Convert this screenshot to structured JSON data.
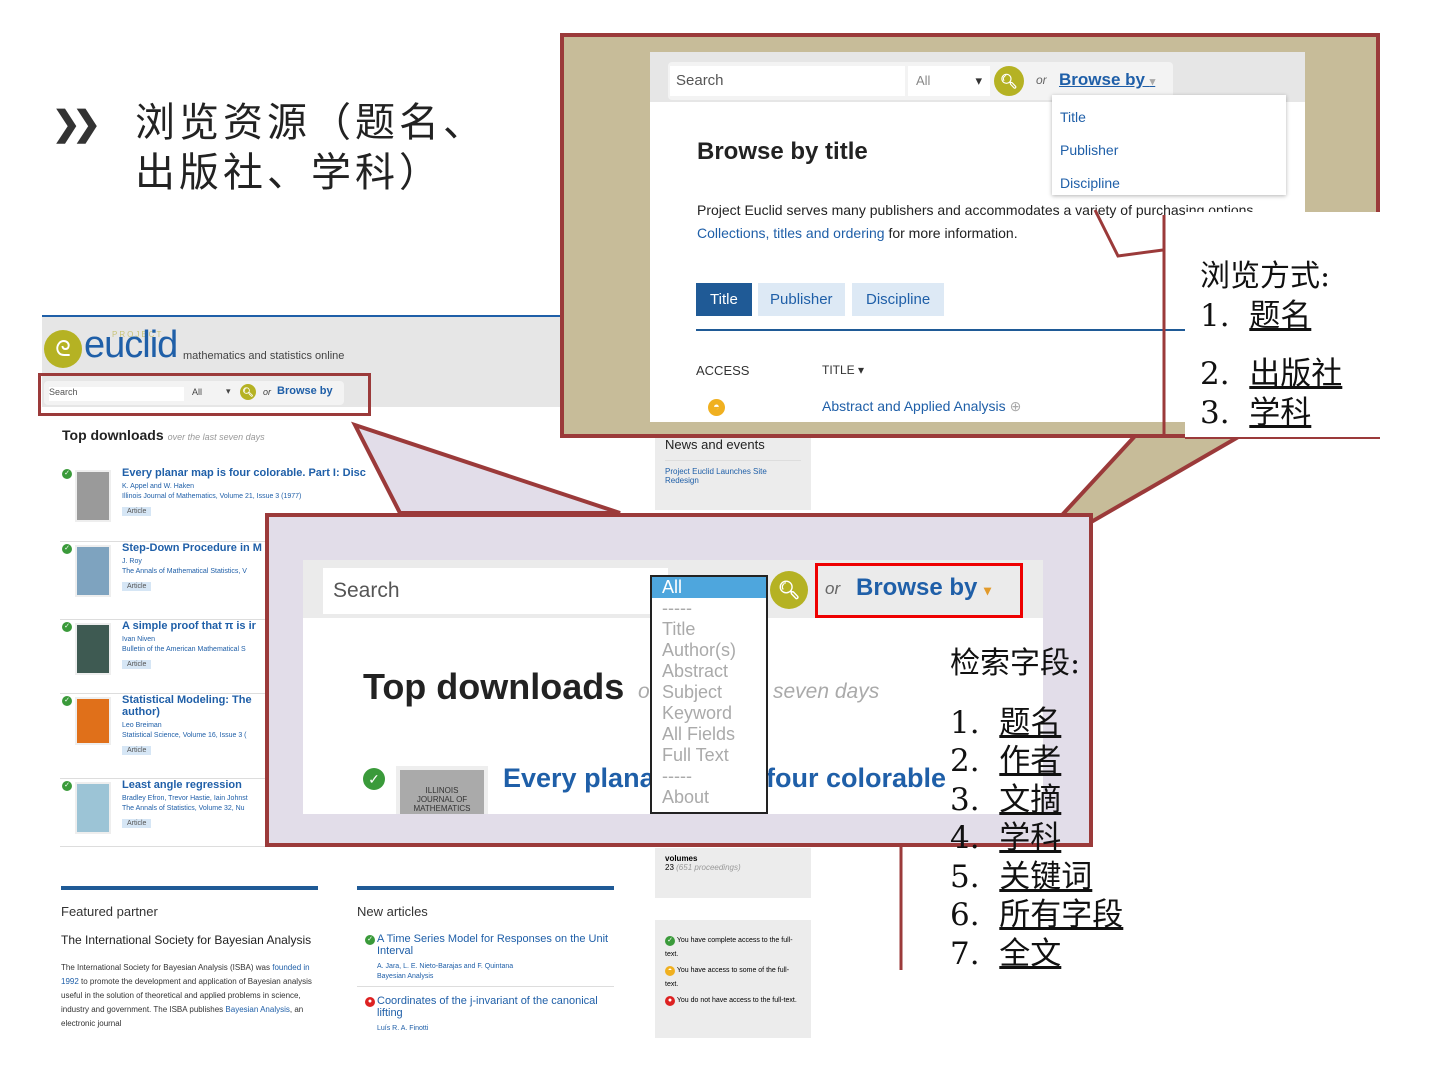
{
  "slide": {
    "title_line1": "浏览资源（题名、",
    "title_line2": "出版社、学科）",
    "bullet_icon": "double-chevron-icon"
  },
  "euclid": {
    "logo_project": "PROJECT",
    "logo": "euclid",
    "tagline": "mathematics and statistics online",
    "search_placeholder": "Search",
    "field_select": "All",
    "or": "or",
    "browse_by": "Browse by",
    "top_downloads": "Top downloads",
    "top_downloads_sub": "over the last seven days",
    "items": [
      {
        "title": "Every planar map is four colorable. Part I: Disc",
        "authors": "K. Appel and W. Haken",
        "source": "Illinois Journal of Mathematics, Volume 21, Issue 3 (1977)",
        "type": "Article"
      },
      {
        "title": "Step-Down Procedure in M",
        "authors": "J. Roy",
        "source": "The Annals of Mathematical Statistics, V",
        "type": "Article"
      },
      {
        "title": "A simple proof that π is ir",
        "authors": "Ivan Niven",
        "source": "Bulletin of the American Mathematical S",
        "type": "Article"
      },
      {
        "title": "Statistical Modeling: The",
        "title2": "author)",
        "authors": "Leo Breiman",
        "source": "Statistical Science, Volume 16, Issue 3 (",
        "type": "Article"
      },
      {
        "title": "Least angle regression",
        "authors": "Bradley Efron, Trevor Hastie, Iain Johnst",
        "source": "The Annals of Statistics, Volume 32, Nu",
        "type": "Article"
      }
    ],
    "news_title": "News and events",
    "news_item": "Project Euclid Launches Site Redesign",
    "volumes_label": "volumes",
    "volumes_value": "23",
    "volumes_sub": "(651 proceedings)",
    "featured_partner": "Featured partner",
    "partner_name": "The International Society for Bayesian Analysis",
    "partner_text_1": "The International Society for Bayesian Analysis (ISBA) was",
    "partner_link_1": "founded in 1992",
    "partner_text_2": "to promote the development and application of Bayesian analysis useful in the solution of theoretical and applied problems in science, industry and government. The ISBA publishes",
    "partner_link_2": "Bayesian Analysis",
    "partner_text_3": ", an electronic journal",
    "new_articles": "New articles",
    "new1_title": "A Time Series Model for Responses on the Unit Interval",
    "new1_authors": "A. Jara, L. E. Nieto-Barajas and F. Quintana",
    "new1_source": "Bayesian Analysis",
    "new2_title": "Coordinates of the j-invariant of the canonical lifting",
    "new2_authors": "Luís R. A. Finotti",
    "legend_full": "You have complete access to the full-text.",
    "legend_some": "You have access to some of the full-text.",
    "legend_none": "You do not have access to the full-text."
  },
  "browse_panel": {
    "search_placeholder": "Search",
    "field_select": "All",
    "or": "or",
    "browse_by": "Browse by",
    "menu": [
      "Title",
      "Publisher",
      "Discipline"
    ],
    "heading": "Browse by title",
    "desc": "Project Euclid serves many publishers and accommodates a variety of purchasing options",
    "desc_link": "Collections, titles and ordering",
    "desc_tail": "for more information.",
    "tabs": [
      "Title",
      "Publisher",
      "Discipline"
    ],
    "col_access": "ACCESS",
    "col_title": "TITLE",
    "first_row": "Abstract and Applied Analysis"
  },
  "zoom_panel": {
    "search_placeholder": "Search",
    "or": "or",
    "browse_by": "Browse by",
    "dropdown": [
      "All",
      "-----",
      "Title",
      "Author(s)",
      "Abstract",
      "Subject",
      "Keyword",
      "All Fields",
      "Full Text",
      "-----",
      "About"
    ],
    "top_downloads": "Top downloads",
    "sub_fragment_left": "o",
    "sub_fragment_right": "seven days",
    "item_fragment_left": "Every plana",
    "item_fragment_right": "four colorable",
    "thumb_text": "ILLINOIS JOURNAL OF MATHEMATICS"
  },
  "callout_browse": {
    "heading": "浏览方式:",
    "items": [
      {
        "n": "1.",
        "t": "题名"
      },
      {
        "n": "2.",
        "t": "出版社"
      },
      {
        "n": "3.",
        "t": "学科"
      }
    ]
  },
  "callout_fields": {
    "heading": "检索字段:",
    "items": [
      {
        "n": "1.",
        "t": "题名"
      },
      {
        "n": "2.",
        "t": "作者"
      },
      {
        "n": "3.",
        "t": "文摘"
      },
      {
        "n": "4.",
        "t": "学科"
      },
      {
        "n": "5.",
        "t": "关键词"
      },
      {
        "n": "6.",
        "t": "所有字段"
      },
      {
        "n": "7.",
        "t": "全文"
      }
    ]
  },
  "colors": {
    "frame": "#9b3a3a",
    "khaki": "#c7bc99",
    "lavender": "#e2dde9",
    "link": "#1f5fa8",
    "olive": "#b5b223"
  }
}
